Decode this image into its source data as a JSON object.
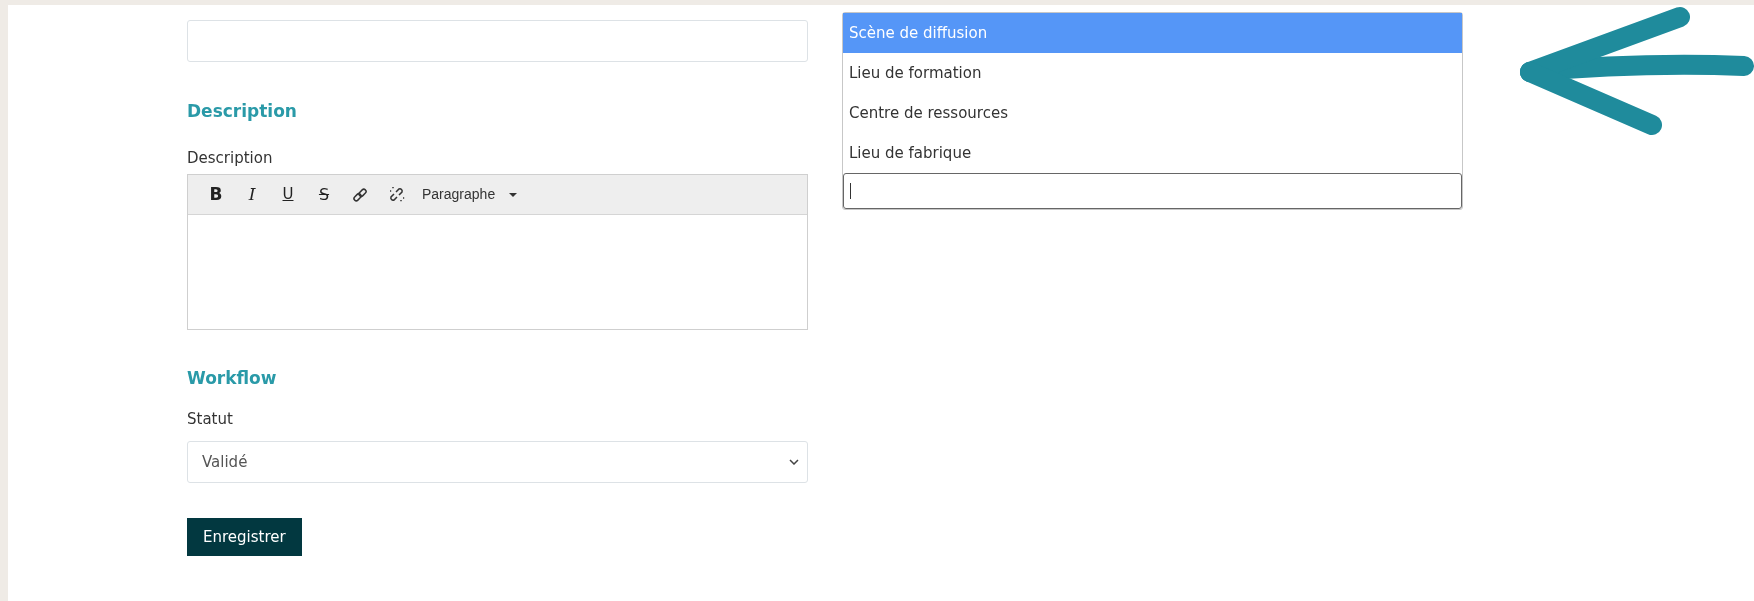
{
  "left": {
    "description": {
      "heading": "Description",
      "label": "Description",
      "toolbar": [
        {
          "kind": "bold",
          "label": "B"
        },
        {
          "kind": "italic",
          "label": "I"
        },
        {
          "kind": "underline",
          "label": "U"
        },
        {
          "kind": "strike",
          "label": "S"
        },
        {
          "kind": "link"
        },
        {
          "kind": "unlink"
        },
        {
          "kind": "format",
          "label": "Paragraphe"
        }
      ]
    },
    "workflow": {
      "heading": "Workflow",
      "label": "Statut",
      "value": "Validé"
    },
    "save_button": "Enregistrer"
  },
  "dropdown": {
    "options": [
      {
        "label": "Scène de diffusion",
        "selected": true
      },
      {
        "label": "Lieu de formation",
        "selected": false
      },
      {
        "label": "Centre de ressources",
        "selected": false
      },
      {
        "label": "Lieu de fabrique",
        "selected": false
      }
    ],
    "search_field": true
  }
}
